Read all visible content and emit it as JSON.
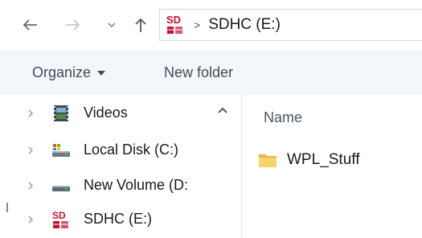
{
  "address": {
    "drive_label": "SDHC (E:)",
    "separator": ">"
  },
  "toolbar": {
    "organize_label": "Organize",
    "new_folder_label": "New folder"
  },
  "nav_pane": {
    "items": [
      {
        "label": "Videos",
        "icon": "videos-icon"
      },
      {
        "label": "Local Disk (C:)",
        "icon": "local-disk-icon"
      },
      {
        "label": "New Volume (D:",
        "icon": "drive-icon"
      },
      {
        "label": "SDHC (E:)",
        "icon": "sdhc-icon"
      }
    ]
  },
  "content": {
    "column_name": "Name",
    "files": [
      {
        "name": "WPL_Stuff",
        "icon": "folder-icon"
      }
    ]
  },
  "icons": {
    "sd_text": "SD"
  },
  "colors": {
    "sd_red": "#c8102e",
    "folder_yellow": "#f4c542",
    "toolbar_bg": "#f3f6fb"
  }
}
